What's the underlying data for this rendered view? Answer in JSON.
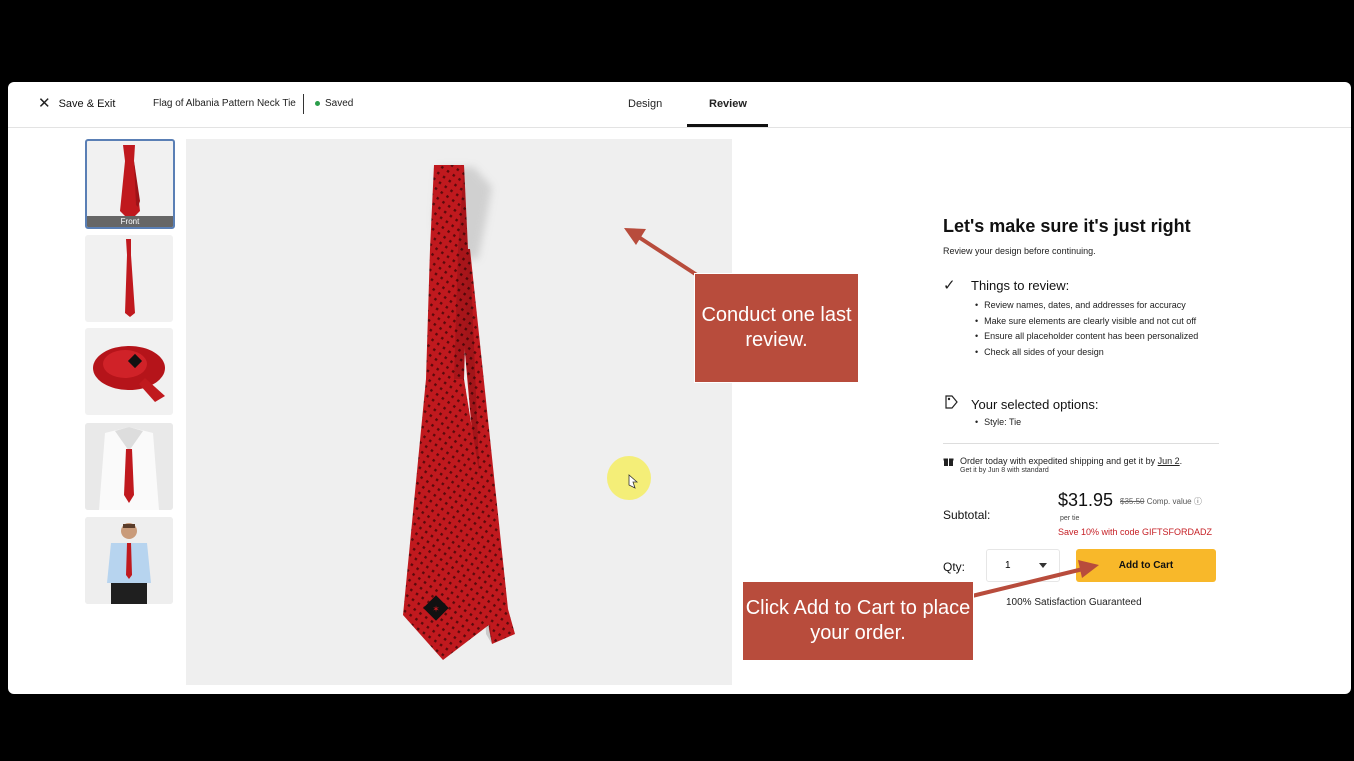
{
  "header": {
    "save_exit": "Save & Exit",
    "doc_title": "Flag of Albania Pattern Neck Tie",
    "status": "Saved",
    "tabs": {
      "design": "Design",
      "review": "Review"
    }
  },
  "thumbnails": [
    {
      "caption": "Front"
    }
  ],
  "review": {
    "title": "Let's make sure it's just right",
    "subtitle": "Review your design before continuing.",
    "things_heading": "Things to review:",
    "things": [
      "Review names, dates, and addresses for accuracy",
      "Make sure elements are clearly visible and not cut off",
      "Ensure all placeholder content has been personalized",
      "Check all sides of your design"
    ],
    "options_heading": "Your selected options:",
    "options": [
      "Style: Tie"
    ],
    "shipping": {
      "line1_pre": "Order today with expedited shipping and get it by ",
      "date": "Jun 2",
      "line1_post": ".",
      "line2": "Get it by Jun 8 with standard"
    },
    "subtotal_label": "Subtotal:",
    "price": "$31.95",
    "comp_price": "$35.50",
    "comp_label": "Comp. value",
    "per_unit": "per tie",
    "promo": "Save 10% with code GIFTSFORDADZ",
    "qty_label": "Qty:",
    "qty_value": "1",
    "add_to_cart": "Add to Cart",
    "guarantee": "100% Satisfaction Guaranteed"
  },
  "callouts": {
    "one": "Conduct one last review.",
    "two": "Click Add to Cart to place your order."
  },
  "colors": {
    "accent": "#f8b82a",
    "callout": "#b84c3c",
    "tie": "#c0191e",
    "promo": "#c62026",
    "saved_dot": "#2a9d4a"
  },
  "icons": [
    "close-icon",
    "check-icon",
    "options-tag-icon",
    "gift-icon",
    "info-icon",
    "chevron-down-icon",
    "cursor-icon"
  ]
}
